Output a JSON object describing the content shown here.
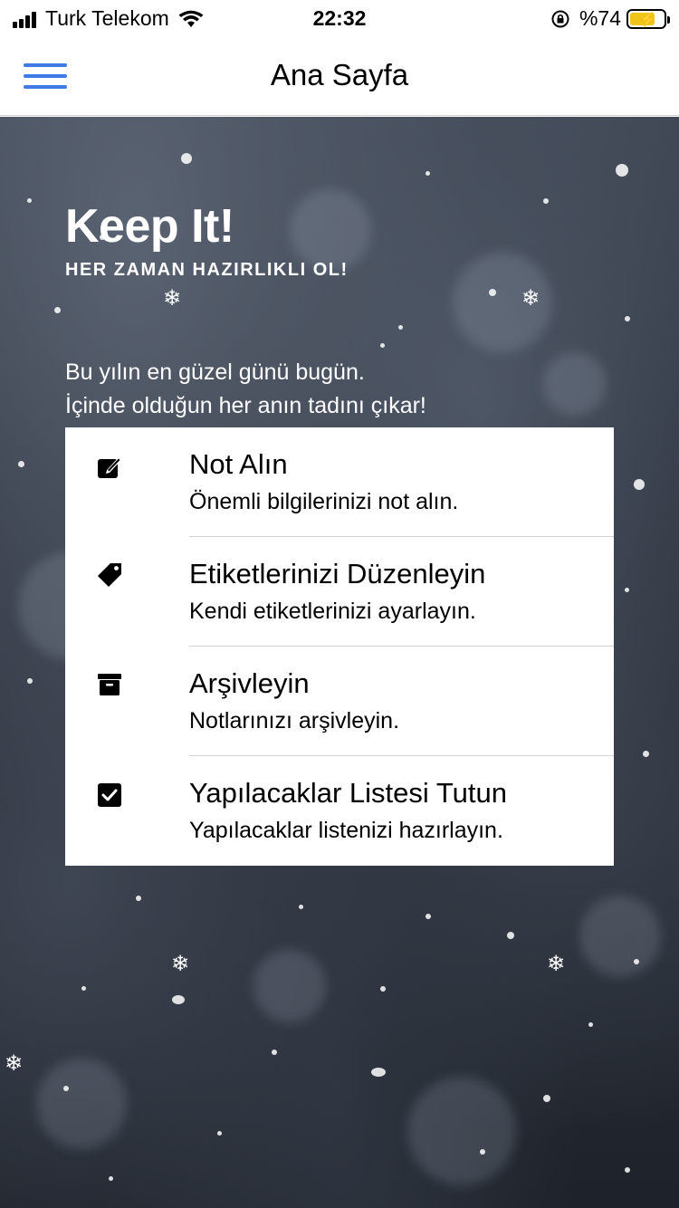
{
  "status_bar": {
    "carrier": "Turk Telekom",
    "time": "22:32",
    "battery_percent": "%74",
    "battery_level": 0.74,
    "icons": [
      "signal-icon",
      "wifi-icon",
      "rotation-lock-icon",
      "battery-icon"
    ]
  },
  "nav": {
    "title": "Ana Sayfa",
    "menu_icon": "hamburger-menu-icon",
    "accent_color": "#3d7ae5"
  },
  "hero": {
    "title": "Keep It!",
    "subtitle": "HER ZAMAN HAZIRLIKLI OL!",
    "intro_line1": "Bu yılın en güzel günü bugün.",
    "intro_line2": "İçinde olduğun her anın tadını çıkar!"
  },
  "features": [
    {
      "icon": "edit-note-icon",
      "title": "Not Alın",
      "description": "Önemli bilgilerinizi not alın."
    },
    {
      "icon": "tag-icon",
      "title": "Etiketlerinizi Düzenleyin",
      "description": "Kendi etiketlerinizi ayarlayın."
    },
    {
      "icon": "archive-icon",
      "title": "Arşivleyin",
      "description": "Notlarınızı arşivleyin."
    },
    {
      "icon": "checkbox-icon",
      "title": "Yapılacaklar Listesi Tutun",
      "description": "Yapılacaklar listenizi hazırlayın."
    }
  ]
}
